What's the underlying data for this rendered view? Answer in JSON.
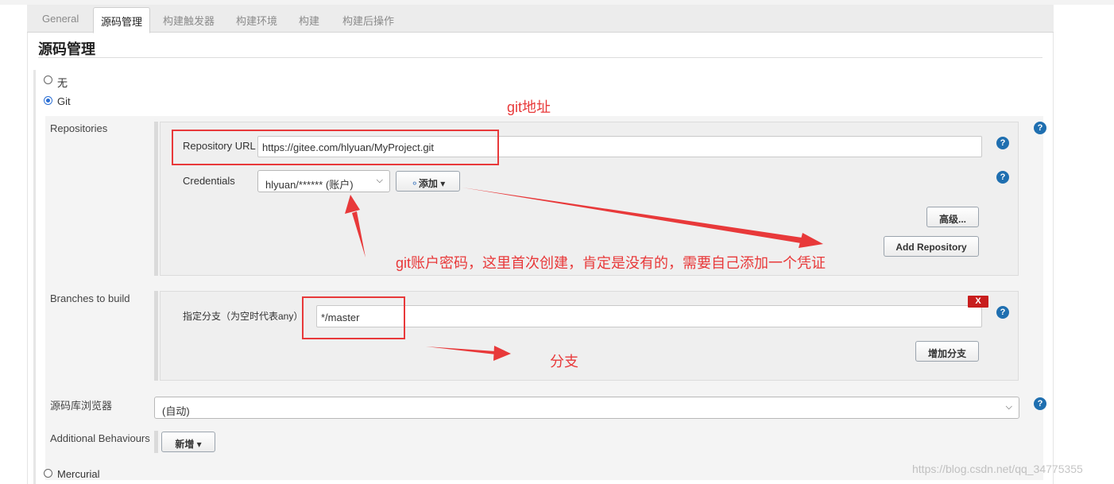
{
  "tabs": [
    "General",
    "源码管理",
    "构建触发器",
    "构建环境",
    "构建",
    "构建后操作"
  ],
  "active_tab": "源码管理",
  "section_title": "源码管理",
  "scm_options": {
    "none": "无",
    "git": "Git",
    "mercurial": "Mercurial",
    "selected": "Git"
  },
  "repositories": {
    "label": "Repositories",
    "url_label": "Repository URL",
    "url_value": "https://gitee.com/hlyuan/MyProject.git",
    "credentials_label": "Credentials",
    "credentials_value": "hlyuan/****** (账户)",
    "add_button": "添加",
    "advanced_button": "高级...",
    "add_repository_button": "Add Repository"
  },
  "branches": {
    "label": "Branches to build",
    "branch_label": "指定分支（为空时代表any）",
    "branch_value": "*/master",
    "delete_button": "X",
    "add_branch_button": "增加分支"
  },
  "browser": {
    "label": "源码库浏览器",
    "value": "(自动)"
  },
  "additional": {
    "label": "Additional Behaviours",
    "button": "新增"
  },
  "help_glyph": "?",
  "annotations": {
    "git_address": "git地址",
    "account_note": "git账户密码，这里首次创建，肯定是没有的，需要自己添加一个凭证",
    "branch_note": "分支",
    "color": "#e8393a"
  },
  "watermark": "https://blog.csdn.net/qq_34775355"
}
